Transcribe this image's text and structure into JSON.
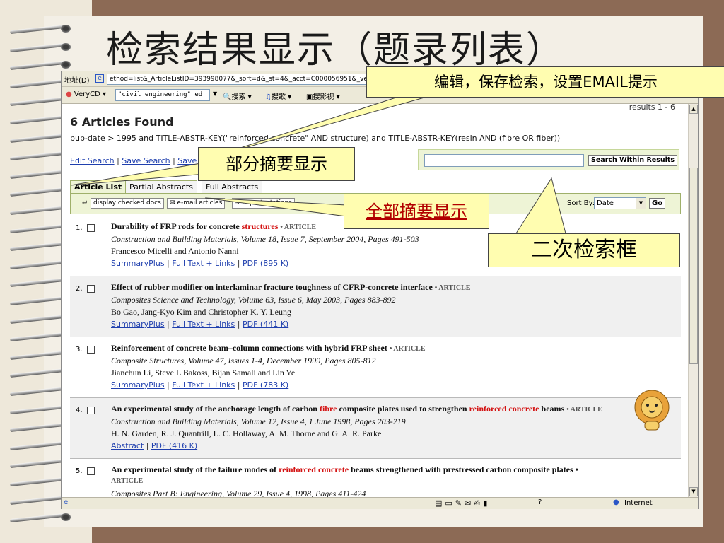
{
  "slide": {
    "title": "检索结果显示（题录列表）"
  },
  "browser": {
    "address_label": "地址(D)",
    "address_url": "ethod=list&_ArticleListID=393998077&_sort=d&_st=4&_acct=C000056951&_version=",
    "toolbar": {
      "verycd": "VeryCD",
      "search_box": "\"civil engineering\" ed",
      "search": "搜索",
      "music": "搜歌",
      "video": "搜影视"
    },
    "status_zone": "Internet"
  },
  "page": {
    "found_title": "6 Articles Found",
    "results_count": "results 1 - 6",
    "query": "pub-date > 1995 and TITLE-ABSTR-KEY(\"reinforced concrete\" AND structure) and TITLE-ABSTR-KEY(resin AND (fibre OR fiber))",
    "links": {
      "edit_search": "Edit Search",
      "save_search": "Save Search",
      "save_as_alert": "Save as Search Alert"
    },
    "search_within_button": "Search Within Results",
    "tabs": {
      "article_list": "Article List",
      "partial_abstracts": "Partial Abstracts",
      "full_abstracts": "Full Abstracts"
    },
    "actions": {
      "display_checked": "display checked docs",
      "email_articles": "e-mail articles",
      "export_citations": "export citations"
    },
    "sort_label": "Sort By:",
    "sort_value": "Date",
    "go": "Go",
    "articles": [
      {
        "num": "1.",
        "title_pre": "Durability of FRP rods for concrete ",
        "title_hl": "structures",
        "title_post": "",
        "type": "• ARTICLE",
        "journal": "Construction and Building Materials, Volume 18, Issue 7, September 2004, Pages 491-503",
        "authors": "Francesco Micelli and Antonio Nanni",
        "link1": "SummaryPlus",
        "link2": "Full Text + Links",
        "link3": "PDF (895 K)"
      },
      {
        "num": "2.",
        "title_pre": "Effect of rubber modifier on interlaminar fracture toughness of CFRP-concrete interface",
        "title_hl": "",
        "title_post": "",
        "type": "• ARTICLE",
        "journal": "Composites Science and Technology, Volume 63, Issue 6, May 2003, Pages 883-892",
        "authors": "Bo Gao, Jang-Kyo Kim and Christopher K. Y. Leung",
        "link1": "SummaryPlus",
        "link2": "Full Text + Links",
        "link3": "PDF (441 K)"
      },
      {
        "num": "3.",
        "title_pre": "Reinforcement of concrete beam–column connections with hybrid FRP sheet",
        "title_hl": "",
        "title_post": "",
        "type": "• ARTICLE",
        "journal": "Composite Structures, Volume 47, Issues 1-4, December 1999, Pages 805-812",
        "authors": "Jianchun Li, Steve L Bakoss, Bijan Samali and Lin Ye",
        "link1": "SummaryPlus",
        "link2": "Full Text + Links",
        "link3": "PDF (783 K)"
      },
      {
        "num": "4.",
        "title_pre": "An experimental study of the anchorage length of carbon ",
        "title_hl": "fibre",
        "title_mid": " composite plates used to strengthen ",
        "title_hl2": "reinforced concrete",
        "title_post": " beams",
        "type": "• ARTICLE",
        "journal": "Construction and Building Materials, Volume 12, Issue 4, 1 June 1998, Pages 203-219",
        "authors": "H. N. Garden, R. J. Quantrill, L. C. Hollaway, A. M. Thorne and G. A. R. Parke",
        "link1": "Abstract",
        "link2": "PDF (416 K)"
      },
      {
        "num": "5.",
        "title_pre": "An experimental study of the failure modes of ",
        "title_hl": "reinforced concrete",
        "title_post": " beams strengthened with prestressed carbon composite plates",
        "type": "ARTICLE",
        "journal": "Composites Part B: Engineering, Volume 29, Issue 4, 1998, Pages 411-424"
      }
    ]
  },
  "callouts": {
    "email": "编辑，保存检索，设置EMAIL提示",
    "partial": "部分摘要显示",
    "full": "全部摘要显示",
    "secondary": "二次检索框"
  },
  "colors": {
    "highlight": "#d31010",
    "link": "#1f3fae",
    "callout_bg": "#fffdb0",
    "panel_green": "#eef4d6"
  }
}
